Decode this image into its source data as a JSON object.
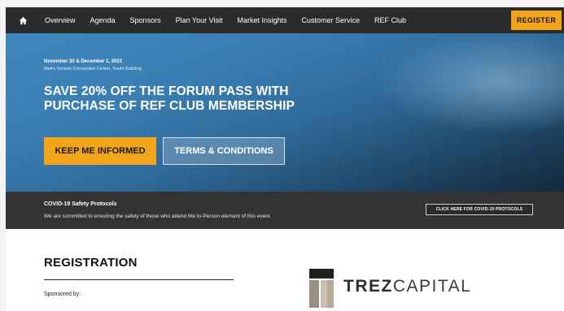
{
  "nav": {
    "home_icon": "home-icon",
    "items": [
      {
        "label": "Overview"
      },
      {
        "label": "Agenda"
      },
      {
        "label": "Sponsors"
      },
      {
        "label": "Plan Your Visit"
      },
      {
        "label": "Market Insights"
      },
      {
        "label": "Customer Service"
      },
      {
        "label": "REF Club"
      }
    ],
    "register_label": "REGISTER"
  },
  "hero": {
    "date": "November 30 & December 1, 2022",
    "venue": "Metro Toronto Convention Centre, South Building",
    "headline": "SAVE 20% OFF THE FORUM PASS WITH PURCHASE OF REF CLUB MEMBERSHIP",
    "primary_button": "KEEP ME INFORMED",
    "secondary_button": "TERMS & CONDITIONS"
  },
  "covid": {
    "title": "COVID-19 Safety Protocols",
    "text": "We are committed to ensuring the safety of those who attend the In-Person element of this event.",
    "button": "CLICK HERE FOR COVID-19 PROTOCOLS"
  },
  "registration": {
    "title": "REGISTRATION",
    "sponsored_label": "Sponsored by:",
    "sponsor_logo_bold": "TREZ",
    "sponsor_logo_light": "CAPITAL"
  },
  "colors": {
    "accent": "#f2a51a",
    "nav_bg": "#2b2b2b",
    "covid_bg": "#333333"
  }
}
